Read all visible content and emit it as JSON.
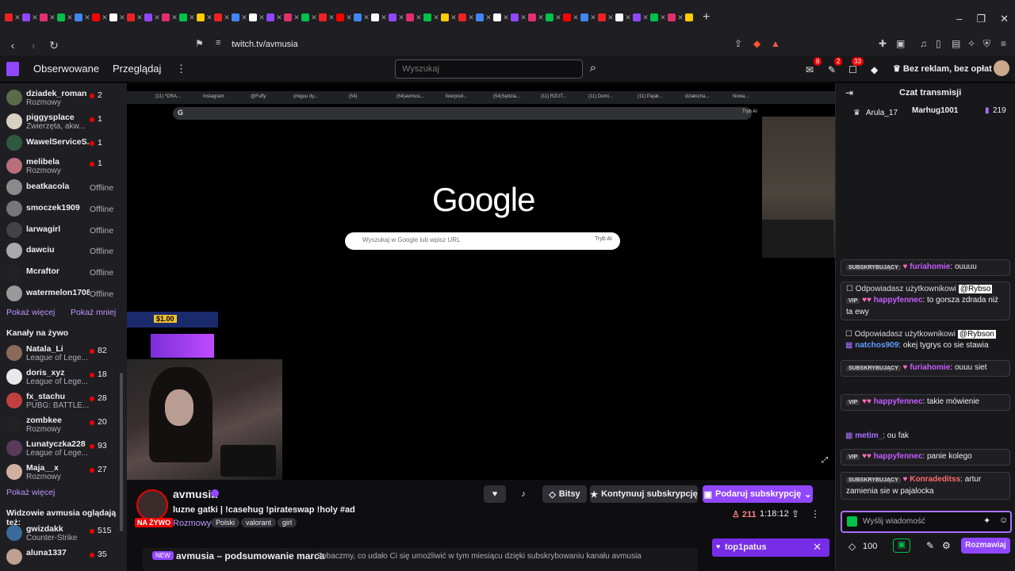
{
  "browser": {
    "address": "twitch.tv/avmusia",
    "new_tab": "+",
    "win_min": "–",
    "win_max": "❐",
    "win_close": "✕",
    "tab_dot_colors": [
      "#e22",
      "#4285f4",
      "#e1306c",
      "#ff0000",
      "#fff",
      "#0af",
      "#9147ff",
      "#00c24a",
      "#e22",
      "#ffcc00"
    ]
  },
  "twitch": {
    "nav": {
      "followed": "Obserwowane",
      "browse": "Przeglądaj",
      "more": "⋮"
    },
    "search_placeholder": "Wyszukaj",
    "badges": {
      "inbox": "8",
      "whispers": "2",
      "notifications": "33"
    },
    "ad_free": "Bez reklam, bez opłat"
  },
  "sidebar": {
    "followed": [
      {
        "name": "dziadek_roman",
        "game": "Rozmowy",
        "viewers": "2",
        "color": "#5a6b4a"
      },
      {
        "name": "piggysplace",
        "game": "Zwierzęta, akw...",
        "viewers": "1",
        "color": "#d9d0c4"
      },
      {
        "name": "WawelServiceS...",
        "game": "",
        "viewers": "1",
        "color": "#2f5a3f"
      },
      {
        "name": "melibela",
        "game": "Rozmowy",
        "viewers": "1",
        "color": "#b86f7a"
      },
      {
        "name": "beatkacola",
        "game": "",
        "status": "Offline",
        "color": "#8a8a8a"
      },
      {
        "name": "smoczek1909",
        "game": "",
        "status": "Offline",
        "color": "#777"
      },
      {
        "name": "larwagirl",
        "game": "",
        "status": "Offline",
        "color": "#444"
      },
      {
        "name": "dawciu",
        "game": "",
        "status": "Offline",
        "color": "#aaa"
      },
      {
        "name": "Mcraftor",
        "game": "",
        "status": "Offline",
        "color": "#222"
      },
      {
        "name": "watermelon1708",
        "game": "",
        "status": "Offline",
        "color": "#999"
      }
    ],
    "show_more": "Pokaż więcej",
    "show_less": "Pokaż mniej",
    "live_header": "Kanały na żywo",
    "live": [
      {
        "name": "Natala_Li",
        "game": "League of Lege...",
        "viewers": "82",
        "color": "#8a6a5a"
      },
      {
        "name": "doris_xyz",
        "game": "League of Lege...",
        "viewers": "18",
        "color": "#e8e8e8"
      },
      {
        "name": "fx_stachu",
        "game": "PUBG: BATTLE...",
        "viewers": "28",
        "color": "#c04040"
      },
      {
        "name": "zombkee",
        "game": "Rozmowy",
        "viewers": "20",
        "color": "#222"
      },
      {
        "name": "Lunatyczka228",
        "game": "League of Lege...",
        "viewers": "93",
        "color": "#5a3a5a"
      },
      {
        "name": "Maja__x",
        "game": "Rozmowy",
        "viewers": "27",
        "color": "#d0b0a0"
      }
    ],
    "show_more2": "Pokaż więcej",
    "also_header": "Widzowie avmusia oglądają też:",
    "also": [
      {
        "name": "gwizdakk",
        "game": "Counter-Strike",
        "viewers": "515",
        "color": "#3a6a9a"
      },
      {
        "name": "aluna1337",
        "game": "",
        "viewers": "35",
        "color": "#c0a090"
      }
    ]
  },
  "video": {
    "inner_tabs": [
      "(11) *DRA...",
      "Instagram",
      "@Fuffy",
      "(miguu dy...",
      "(54)",
      "(54)avmusi...",
      "liverpool...",
      "(54)Sędzia...",
      "(11) RZUT...",
      "(11) Domi...",
      "(11) Pajak...",
      "działocha...",
      "Nowa..."
    ],
    "google": "Google",
    "google_search": "Wyszukaj w Google lub wpisz URL",
    "tryb_ai": "Tryb AI",
    "promo_amount": "$1.00"
  },
  "stream": {
    "name": "avmusia",
    "live": "NA ŻYWO",
    "title": "luzne gatki | !casehug !pirateswap !holy #ad",
    "category": "Rozmowy",
    "tags": [
      "Polski",
      "valorant",
      "girl"
    ],
    "bits": "Bitsy",
    "continue_sub": "Kontynuuj subskrypcję",
    "gift_sub": "Podaruj subskrypcję",
    "viewers": "211",
    "uptime": "1:18:12",
    "recap_new": "NEW",
    "recap_title": "avmusia – podsumowanie marca",
    "recap_desc": "Zobaczmy, co udało Ci się umożliwić w tym miesiącu dzięki subskrybowaniu kanału avmusia",
    "toast_user": "top1patus"
  },
  "chat": {
    "title": "Czat transmisji",
    "hype_user1": "Arula_17",
    "hype_user2": "Marhug1001",
    "hype_count": "219",
    "sub_badge": "SUBSKRYBUJĄCY",
    "vip_badge": "VIP",
    "replying": "Odpowiadasz użytkownikowi",
    "messages": [
      {
        "user": "furiahomie",
        "text": ": ouuuu"
      },
      {
        "reply_to": "@Rybso",
        "user": "happyfennec",
        "text": ": to gorsza zdrada niż ta ewy"
      },
      {
        "reply_to": "@Rybson",
        "user": "natchos909",
        "text": ": okej tygrys co sie stawia"
      },
      {
        "user": "furiahomie",
        "text": ": ouuu siet"
      },
      {
        "user": "happyfennec",
        "text": ": takie mówienie"
      },
      {
        "user": "metim_",
        "text": ": ou fak"
      },
      {
        "user": "happyfennec",
        "text": ": panie kolego"
      },
      {
        "user": "Konradeditss",
        "text": ": artur zamienia sie w pajalocka"
      }
    ],
    "input_placeholder": "Wyślij wiadomość",
    "points": "100",
    "send": "Rozmawiaj"
  }
}
